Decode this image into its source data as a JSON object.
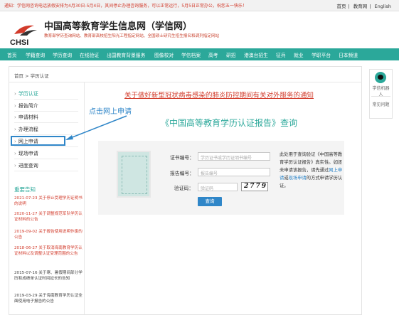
{
  "topbar": {
    "notice": "通知：学信网咨询电话放假安排为4月30日-5月4日，其间停止办理咨询服务，可以正常运行，5月5日正常办公，祝您五一快乐！",
    "links": [
      "首页",
      "教育网",
      "English"
    ]
  },
  "header": {
    "logo_text": "CHSI",
    "title": "中国高等教育学生信息网（学信网）",
    "subtitle": "教育部学历查询网站、教育部高校招生阳光工程指定网站、全国硕士研究生招生报名和调剂指定网站"
  },
  "nav": [
    "首页",
    "学籍查询",
    "学历查询",
    "在线验证",
    "出国教育背景服务",
    "图像校对",
    "学信档案",
    "高考",
    "研招",
    "港澳台招生",
    "征兵",
    "就业",
    "学职平台",
    "日本频道"
  ],
  "breadcrumb": "首页 > 学历认证",
  "sidebar": {
    "items": [
      "学历认证",
      "报告简介",
      "申请材料",
      "办理流程",
      "网上申请",
      "现场申请",
      "进度查询"
    ]
  },
  "news": {
    "title": "重要告知",
    "items": [
      {
        "date": "2021-07-23",
        "text": "关于停止受理学历证明书的说明",
        "color": "#d23b2b"
      },
      {
        "date": "2020-11-27",
        "text": "关于调整规范军队学历认证材料的公告",
        "color": "#d23b2b"
      },
      {
        "date": "2019-09-02",
        "text": "关于报告使用说明作废的公告",
        "color": "#d23b2b"
      },
      {
        "date": "2018-06-27",
        "text": "关于取消海南教育学历认证材料以及调整认证受理范围的公告",
        "color": "#d23b2b"
      },
      {
        "date": "2015-07-16",
        "text": "关于寒、暑假期间部分学历和成绩单认证时间延长的告知",
        "color": "#444444"
      },
      {
        "date": "2019-03-29",
        "text": "关于海南教育学历认证全面使用电子报告的公告",
        "color": "#444444"
      }
    ]
  },
  "main": {
    "covid_notice": "关于做好新型冠状病毒感染的肺炎防控期间有关对外服务的通知",
    "annotation": "点击网上申请",
    "query_title": "《中国高等教育学历认证报告》查询",
    "form": {
      "cert_label": "证书编号：",
      "cert_placeholder": "学历证书或学历证明书编号",
      "report_label": "报告编号：",
      "report_placeholder": "报告编号",
      "captcha_label": "验证码：",
      "captcha_placeholder": "验证码",
      "captcha_value": "2779",
      "submit": "查询"
    },
    "help": {
      "pre": "此处用于查询验证《中国高等教育学历认证报告》真实性。如还未申请该报告，请先通过",
      "link1": "网上申请",
      "mid": "或",
      "link2": "现场申请",
      "post": "的方式申请学历认证。"
    }
  },
  "rail": {
    "robot_label": "学信机器人",
    "faq_label": "常见问题"
  },
  "colors": {
    "accent": "#2ba89a",
    "alert": "#d23b2b",
    "link": "#2f86c8"
  }
}
